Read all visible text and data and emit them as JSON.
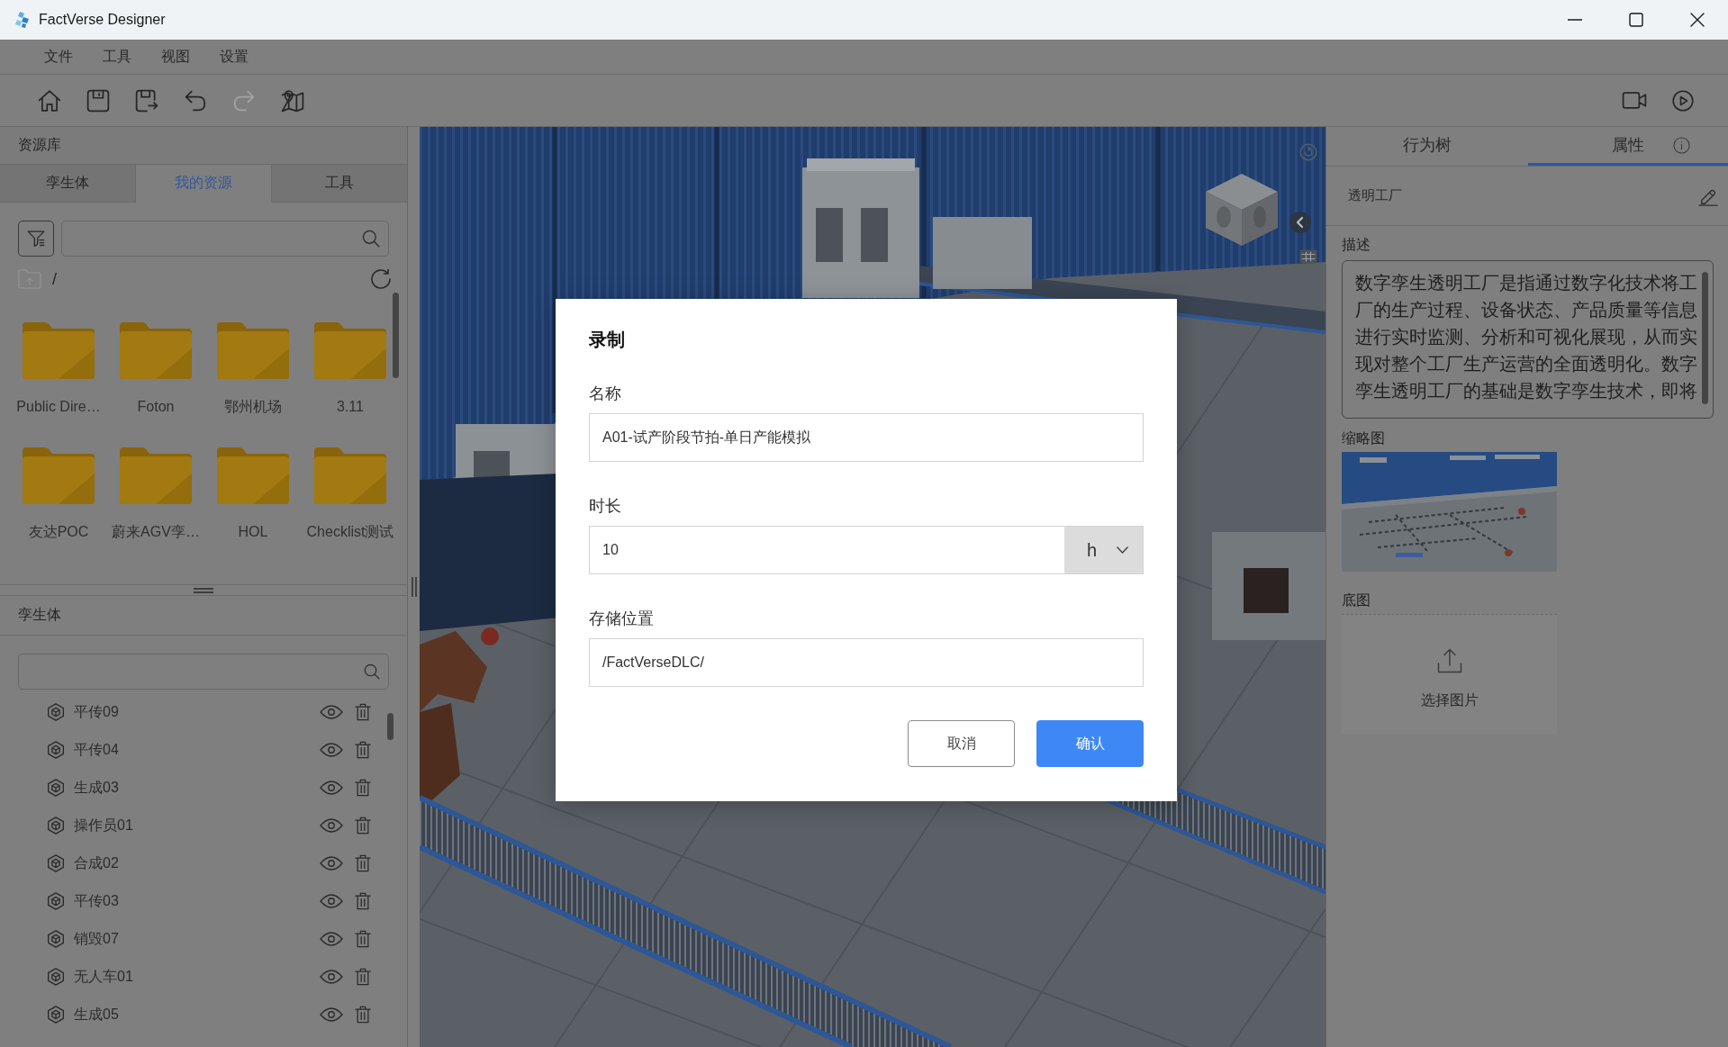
{
  "window": {
    "title": "FactVerse Designer"
  },
  "menu": [
    "文件",
    "工具",
    "视图",
    "设置"
  ],
  "toolbar": [
    {
      "kind": "home",
      "disabled": false
    },
    {
      "kind": "save",
      "disabled": false
    },
    {
      "kind": "save_as",
      "disabled": false
    },
    {
      "kind": "undo",
      "disabled": false
    },
    {
      "kind": "redo",
      "disabled": true
    },
    {
      "kind": "map",
      "disabled": false
    }
  ],
  "toolbar_right": [
    {
      "kind": "record"
    },
    {
      "kind": "play"
    }
  ],
  "resource_library": {
    "title": "资源库",
    "tabs": [
      {
        "label": "孪生体",
        "selected": false
      },
      {
        "label": "我的资源",
        "selected": true
      },
      {
        "label": "工具",
        "selected": false
      }
    ],
    "up_disabled": true,
    "path": "/",
    "folders": [
      "Public Dire…",
      "Foton",
      "鄂州机场",
      "3.11",
      "友达POC",
      "蔚来AGV孪…",
      "HOL",
      "Checklist测试"
    ]
  },
  "twins": {
    "title": "孪生体",
    "items": [
      "平传09",
      "平传04",
      "生成03",
      "操作员01",
      "合成02",
      "平传03",
      "销毁07",
      "无人车01",
      "生成05"
    ]
  },
  "properties": {
    "tabs": [
      {
        "label": "行为树",
        "selected": false
      },
      {
        "label": "属性",
        "selected": true
      }
    ],
    "object_name": "透明工厂",
    "description_label": "描述",
    "description": "数字孪生透明工厂是指通过数字化技术将工厂的生产过程、设备状态、产品质量等信息进行实时监测、分析和可视化展现，从而实现对整个工厂生产运营的全面透明化。数字孪生透明工厂的基础是数字孪生技术，即将",
    "thumbnail_label": "缩略图",
    "base_map_label": "底图",
    "upload_label": "选择图片"
  },
  "dialog": {
    "title": "录制",
    "fields": [
      {
        "kind": "text",
        "label": "名称",
        "value": "A01-试产阶段节拍-单日产能模拟"
      },
      {
        "kind": "number_unit",
        "label": "时长",
        "value": "10",
        "unit": "h"
      },
      {
        "kind": "text",
        "label": "存储位置",
        "value": "/FactVerseDLC/"
      }
    ],
    "buttons": [
      {
        "kind": "secondary",
        "label": "取消"
      },
      {
        "kind": "primary",
        "label": "确认"
      }
    ]
  }
}
